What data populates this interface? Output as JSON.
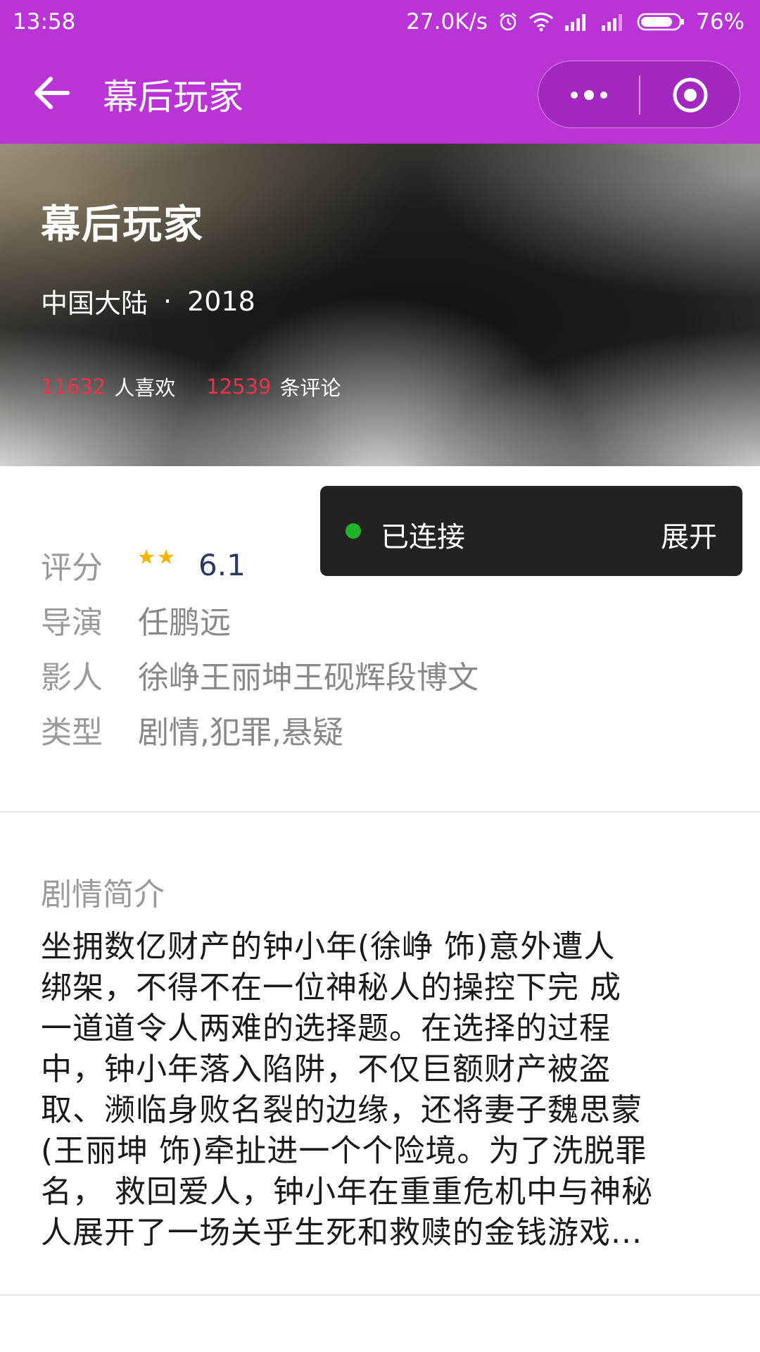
{
  "status_bar": {
    "time": "13:58",
    "net_speed": "27.0K/s",
    "battery": "76%",
    "icons": [
      "alarm-icon",
      "wifi-icon",
      "signal-icon",
      "signal-icon",
      "battery-icon"
    ]
  },
  "nav": {
    "title": "幕后玩家",
    "back_icon": "arrow-left-icon",
    "more_icon": "more-dots-icon",
    "close_icon": "target-close-icon"
  },
  "hero": {
    "title": "幕后玩家",
    "region": "中国大陆",
    "separator": "·",
    "year": "2018",
    "likes_count": "11632",
    "likes_label": "人喜欢",
    "comments_count": "12539",
    "comments_label": "条评论"
  },
  "toast": {
    "status": "已连接",
    "action": "展开",
    "dot_color": "#1fb327"
  },
  "info": {
    "rating_label": "评分",
    "stars_filled": 2,
    "rating": "6.1",
    "director_label": "导演",
    "director": "任鹏远",
    "cast_label": "影人",
    "cast": "徐峥王丽坤王砚辉段博文",
    "genre_label": "类型",
    "genre": "剧情,犯罪,悬疑"
  },
  "synopsis": {
    "title": "剧情简介",
    "lines": [
      "坐拥数亿财产的钟小年(徐峥 饰)意外遭人",
      "绑架，不得不在一位神秘人的操控下完 成",
      "一道道令人两难的选择题。在选择的过程",
      "中，钟小年落入陷阱，不仅巨额财产被盗",
      "取、濒临身败名裂的边缘，还将妻子魏思蒙",
      "(王丽坤 饰)牵扯进一个个险境。为了洗脱罪",
      "名， 救回爱人，钟小年在重重危机中与神秘",
      "人展开了一场关乎生死和救赎的金钱游戏..."
    ]
  },
  "colors": {
    "brand": "#b933d6",
    "count_red": "#e8354a",
    "star": "#f5b400",
    "rating": "#2b3a64"
  }
}
